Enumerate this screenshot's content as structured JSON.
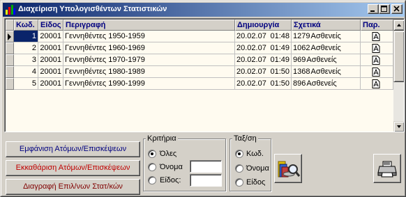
{
  "window": {
    "title": "Διαχείριση Υπολογισθέντων Στατιστικών"
  },
  "grid": {
    "columns": [
      "Κωδ.",
      "Είδος",
      "Περιγραφή",
      "Δημιουργία",
      "Σχετικά",
      "Παρ."
    ],
    "rows": [
      {
        "code": "1",
        "type": "20001",
        "description": "Γεννηθέντες 1950-1959",
        "date": "20.02.07",
        "time": "01:48",
        "count": "1279",
        "related": "Ασθενείς",
        "selected": true
      },
      {
        "code": "2",
        "type": "20001",
        "description": "Γεννηθέντες 1960-1969",
        "date": "20.02.07",
        "time": "01:49",
        "count": "1062",
        "related": "Ασθενείς",
        "selected": false
      },
      {
        "code": "3",
        "type": "20001",
        "description": "Γεννηθέντες 1970-1979",
        "date": "20.02.07",
        "time": "01:49",
        "count": "969",
        "related": "Ασθενείς",
        "selected": false
      },
      {
        "code": "4",
        "type": "20001",
        "description": "Γεννηθέντες 1980-1989",
        "date": "20.02.07",
        "time": "01:50",
        "count": "1368",
        "related": "Ασθενείς",
        "selected": false
      },
      {
        "code": "5",
        "type": "20001",
        "description": "Γεννηθέντες 1990-1999",
        "date": "20.02.07",
        "time": "01:50",
        "count": "896",
        "related": "Ασθενείς",
        "selected": false
      }
    ]
  },
  "actions": {
    "show_label": "Εμφάνιση Ατόμων/Επισκέψεων",
    "clear_label": "Εκκαθάριση Ατόμων/Επισκέψεων",
    "delete_label": "Διαγραφή Επιλ/νων Στατ/κών"
  },
  "criteria": {
    "legend": "Κριτήρια",
    "options": [
      "Όλες",
      "Όνομα",
      "Είδος:"
    ],
    "selected": 0
  },
  "sort": {
    "legend": "Ταξ/ση",
    "options": [
      "Κωδ.",
      "Όνομα",
      "Είδος"
    ],
    "selected": 0
  },
  "colors": {
    "title_start": "#0a246a",
    "title_end": "#a6caf0",
    "header_text": "#000080",
    "clear_text": "#c00000",
    "show_text": "#000080",
    "grid_bg": "#fffbf0"
  }
}
